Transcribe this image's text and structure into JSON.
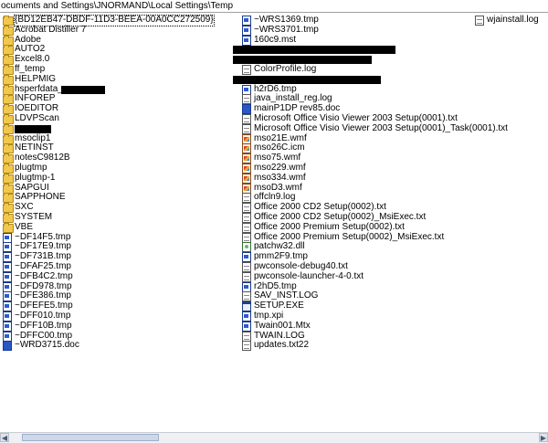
{
  "address_bar": {
    "path": "ocuments and Settings\\JNORMAND\\Local Settings\\Temp"
  },
  "columns": [
    {
      "items": [
        {
          "label": "{BD12EB47-DBDF-11D3-BEEA-00A0CC272509}",
          "icon": "folder",
          "focused": true
        },
        {
          "label": "Acrobat Distiller 7",
          "icon": "folder"
        },
        {
          "label": "Adobe",
          "icon": "folder"
        },
        {
          "label": "AUTO2",
          "icon": "folder"
        },
        {
          "label": "Excel8.0",
          "icon": "folder"
        },
        {
          "label": "ff_temp",
          "icon": "folder"
        },
        {
          "label": "HELPMIG",
          "icon": "folder"
        },
        {
          "label": "hsperfdata_",
          "icon": "folder",
          "redacted_suffix": true
        },
        {
          "label": "INFOREP",
          "icon": "folder"
        },
        {
          "label": "IOEDITOR",
          "icon": "folder"
        },
        {
          "label": "LDVPScan",
          "icon": "folder"
        },
        {
          "label": "",
          "icon": "folder",
          "redacted_only": true
        },
        {
          "label": "msoclip1",
          "icon": "folder"
        },
        {
          "label": "NETINST",
          "icon": "folder"
        },
        {
          "label": "notesC9812B",
          "icon": "folder"
        },
        {
          "label": "plugtmp",
          "icon": "folder"
        },
        {
          "label": "plugtmp-1",
          "icon": "folder"
        },
        {
          "label": "SAPGUI",
          "icon": "folder"
        },
        {
          "label": "SAPPHONE",
          "icon": "folder"
        },
        {
          "label": "SXC",
          "icon": "folder"
        },
        {
          "label": "SYSTEM",
          "icon": "folder"
        },
        {
          "label": "VBE",
          "icon": "folder"
        },
        {
          "label": "~DF14F5.tmp",
          "icon": "tmp"
        },
        {
          "label": "~DF17E9.tmp",
          "icon": "tmp"
        },
        {
          "label": "~DF731B.tmp",
          "icon": "tmp"
        },
        {
          "label": "~DFAF25.tmp",
          "icon": "tmp"
        },
        {
          "label": "~DFB4C2.tmp",
          "icon": "tmp"
        },
        {
          "label": "~DFD978.tmp",
          "icon": "tmp"
        },
        {
          "label": "~DFE386.tmp",
          "icon": "tmp"
        },
        {
          "label": "~DFEFE5.tmp",
          "icon": "tmp"
        },
        {
          "label": "~DFF010.tmp",
          "icon": "tmp"
        },
        {
          "label": "~DFF10B.tmp",
          "icon": "tmp"
        },
        {
          "label": "~DFFC00.tmp",
          "icon": "tmp"
        },
        {
          "label": "~WRD3715.doc",
          "icon": "word"
        }
      ]
    },
    {
      "items": [
        {
          "label": "~WRS1369.tmp",
          "icon": "tmp"
        },
        {
          "label": "~WRS3701.tmp",
          "icon": "tmp"
        },
        {
          "label": "160c9.mst",
          "icon": "tmp"
        },
        {
          "label": "",
          "icon": "none",
          "redacted_only": true
        },
        {
          "label": "",
          "icon": "none",
          "redacted_only": true
        },
        {
          "label": "ColorProfile.log",
          "icon": "doc"
        },
        {
          "label": "",
          "icon": "none",
          "redacted_only": true
        },
        {
          "label": "h2rD6.tmp",
          "icon": "tmp"
        },
        {
          "label": "java_install_reg.log",
          "icon": "doc"
        },
        {
          "label": "mainP1DP rev85.doc",
          "icon": "word"
        },
        {
          "label": "Microsoft Office Visio Viewer 2003 Setup(0001).txt",
          "icon": "doc"
        },
        {
          "label": "Microsoft Office Visio Viewer 2003 Setup(0001)_Task(0001).txt",
          "icon": "doc"
        },
        {
          "label": "mso21E.wmf",
          "icon": "wmf"
        },
        {
          "label": "mso26C.icm",
          "icon": "wmf"
        },
        {
          "label": "mso75.wmf",
          "icon": "wmf"
        },
        {
          "label": "mso229.wmf",
          "icon": "wmf"
        },
        {
          "label": "mso334.wmf",
          "icon": "wmf"
        },
        {
          "label": "msoD3.wmf",
          "icon": "wmf"
        },
        {
          "label": "offcln9.log",
          "icon": "doc"
        },
        {
          "label": "Office 2000 CD2 Setup(0002).txt",
          "icon": "doc"
        },
        {
          "label": "Office 2000 CD2 Setup(0002)_MsiExec.txt",
          "icon": "doc"
        },
        {
          "label": "Office 2000 Premium Setup(0002).txt",
          "icon": "doc"
        },
        {
          "label": "Office 2000 Premium Setup(0002)_MsiExec.txt",
          "icon": "doc"
        },
        {
          "label": "patchw32.dll",
          "icon": "dll"
        },
        {
          "label": "pmm2F9.tmp",
          "icon": "tmp"
        },
        {
          "label": "pwconsole-debug40.txt",
          "icon": "doc"
        },
        {
          "label": "pwconsole-launcher-4-0.txt",
          "icon": "doc"
        },
        {
          "label": "r2hD5.tmp",
          "icon": "tmp"
        },
        {
          "label": "SAV_INST.LOG",
          "icon": "doc"
        },
        {
          "label": "SETUP.EXE",
          "icon": "exe"
        },
        {
          "label": "tmp.xpi",
          "icon": "tmp"
        },
        {
          "label": "Twain001.Mtx",
          "icon": "tmp"
        },
        {
          "label": "TWAIN.LOG",
          "icon": "doc"
        },
        {
          "label": "updates.txt22",
          "icon": "doc"
        }
      ]
    },
    {
      "items": [
        {
          "label": "wjainstall.log",
          "icon": "doc"
        }
      ]
    }
  ],
  "scrollbar": {
    "left_arrow": "◀",
    "right_arrow": "▶"
  }
}
